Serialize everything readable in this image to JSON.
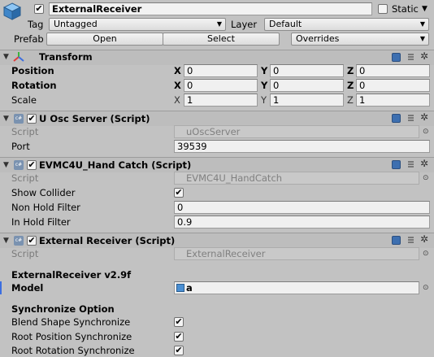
{
  "object": {
    "name": "ExternalReceiver",
    "static_label": "Static",
    "tag_label": "Tag",
    "tag_value": "Untagged",
    "layer_label": "Layer",
    "layer_value": "Default",
    "prefab_label": "Prefab",
    "open_label": "Open",
    "select_label": "Select",
    "overrides_label": "Overrides"
  },
  "transform": {
    "title": "Transform",
    "rows": [
      {
        "label": "Position",
        "x": "0",
        "y": "0",
        "z": "0"
      },
      {
        "label": "Rotation",
        "x": "0",
        "y": "0",
        "z": "0"
      },
      {
        "label": "Scale",
        "x": "1",
        "y": "1",
        "z": "1"
      }
    ],
    "axis_x": "X",
    "axis_y": "Y",
    "axis_z": "Z"
  },
  "osc": {
    "title": "U Osc Server (Script)",
    "script_label": "Script",
    "script_value": "uOscServer",
    "port_label": "Port",
    "port_value": "39539"
  },
  "hand": {
    "title": "EVMC4U_Hand Catch (Script)",
    "script_label": "Script",
    "script_value": "EVMC4U_HandCatch",
    "show_collider_label": "Show Collider",
    "non_hold_label": "Non Hold Filter",
    "non_hold_value": "0",
    "in_hold_label": "In Hold Filter",
    "in_hold_value": "0.9"
  },
  "receiver": {
    "title": "External Receiver (Script)",
    "script_label": "Script",
    "script_value": "ExternalReceiver",
    "version": "ExternalReceiver v2.9f",
    "model_label": "Model",
    "model_value": "a",
    "sync_header": "Synchronize Option",
    "blend_label": "Blend Shape Synchronize",
    "rootpos_label": "Root Position Synchronize",
    "rootrot_label": "Root Rotation Synchronize"
  },
  "colors": {
    "background": "#c2c2c2",
    "header": "#bdbdbd",
    "help_icon": "#3d6fb0"
  }
}
